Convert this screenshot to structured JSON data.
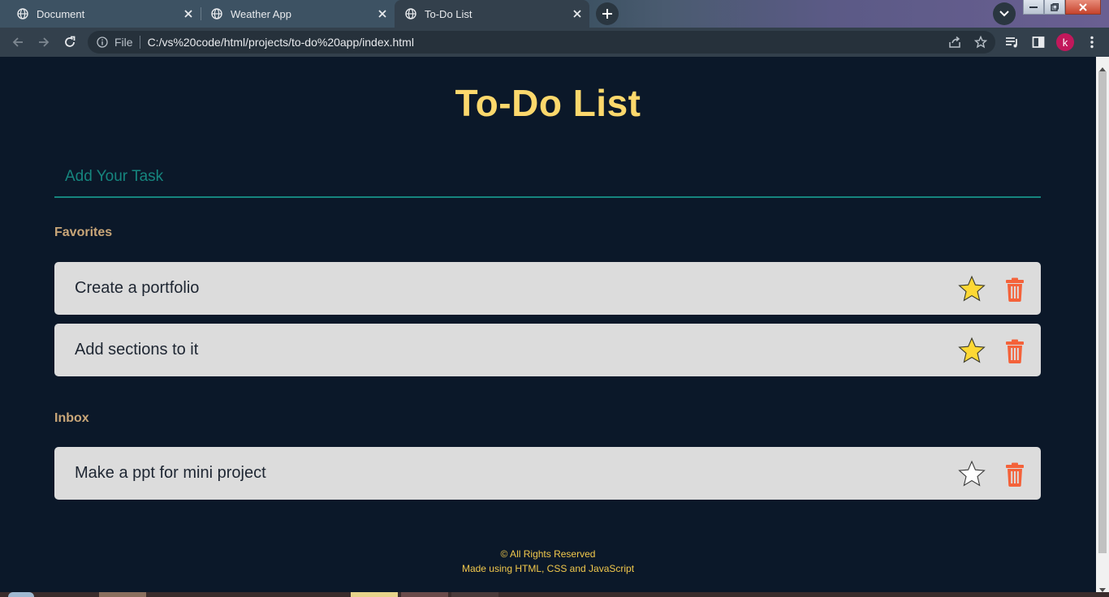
{
  "browser": {
    "tabs": [
      {
        "title": "Document",
        "active": false
      },
      {
        "title": "Weather App",
        "active": false
      },
      {
        "title": "To-Do List",
        "active": true
      }
    ],
    "omnibox": {
      "scheme_label": "File",
      "url": "C:/vs%20code/html/projects/to-do%20app/index.html"
    },
    "profile_initial": "k",
    "icons": [
      "globe-icon",
      "close-icon",
      "plus-icon",
      "chevron-down-icon",
      "back-icon",
      "forward-icon",
      "reload-icon",
      "info-icon",
      "share-icon",
      "star-icon",
      "reading-list-icon",
      "side-panel-icon",
      "more-icon"
    ]
  },
  "app": {
    "title": "To-Do List",
    "input_placeholder": "Add Your Task",
    "sections": [
      {
        "label": "Favorites",
        "tasks": [
          {
            "text": "Create a portfolio",
            "favorite": true
          },
          {
            "text": "Add sections to it",
            "favorite": true
          }
        ]
      },
      {
        "label": "Inbox",
        "tasks": [
          {
            "text": "Make a ppt for mini project",
            "favorite": false
          }
        ]
      }
    ],
    "footer": {
      "line1": "© All Rights Reserved",
      "line2": "Made using HTML, CSS and JavaScript"
    }
  },
  "colors": {
    "background": "#0b1829",
    "title": "#fcd86c",
    "accent_teal": "#16857e",
    "section_label": "#c9a678",
    "card": "#dcdcdc",
    "star_fill": "#fdd835",
    "trash": "#f4623a",
    "footer": "#f2c94c"
  }
}
